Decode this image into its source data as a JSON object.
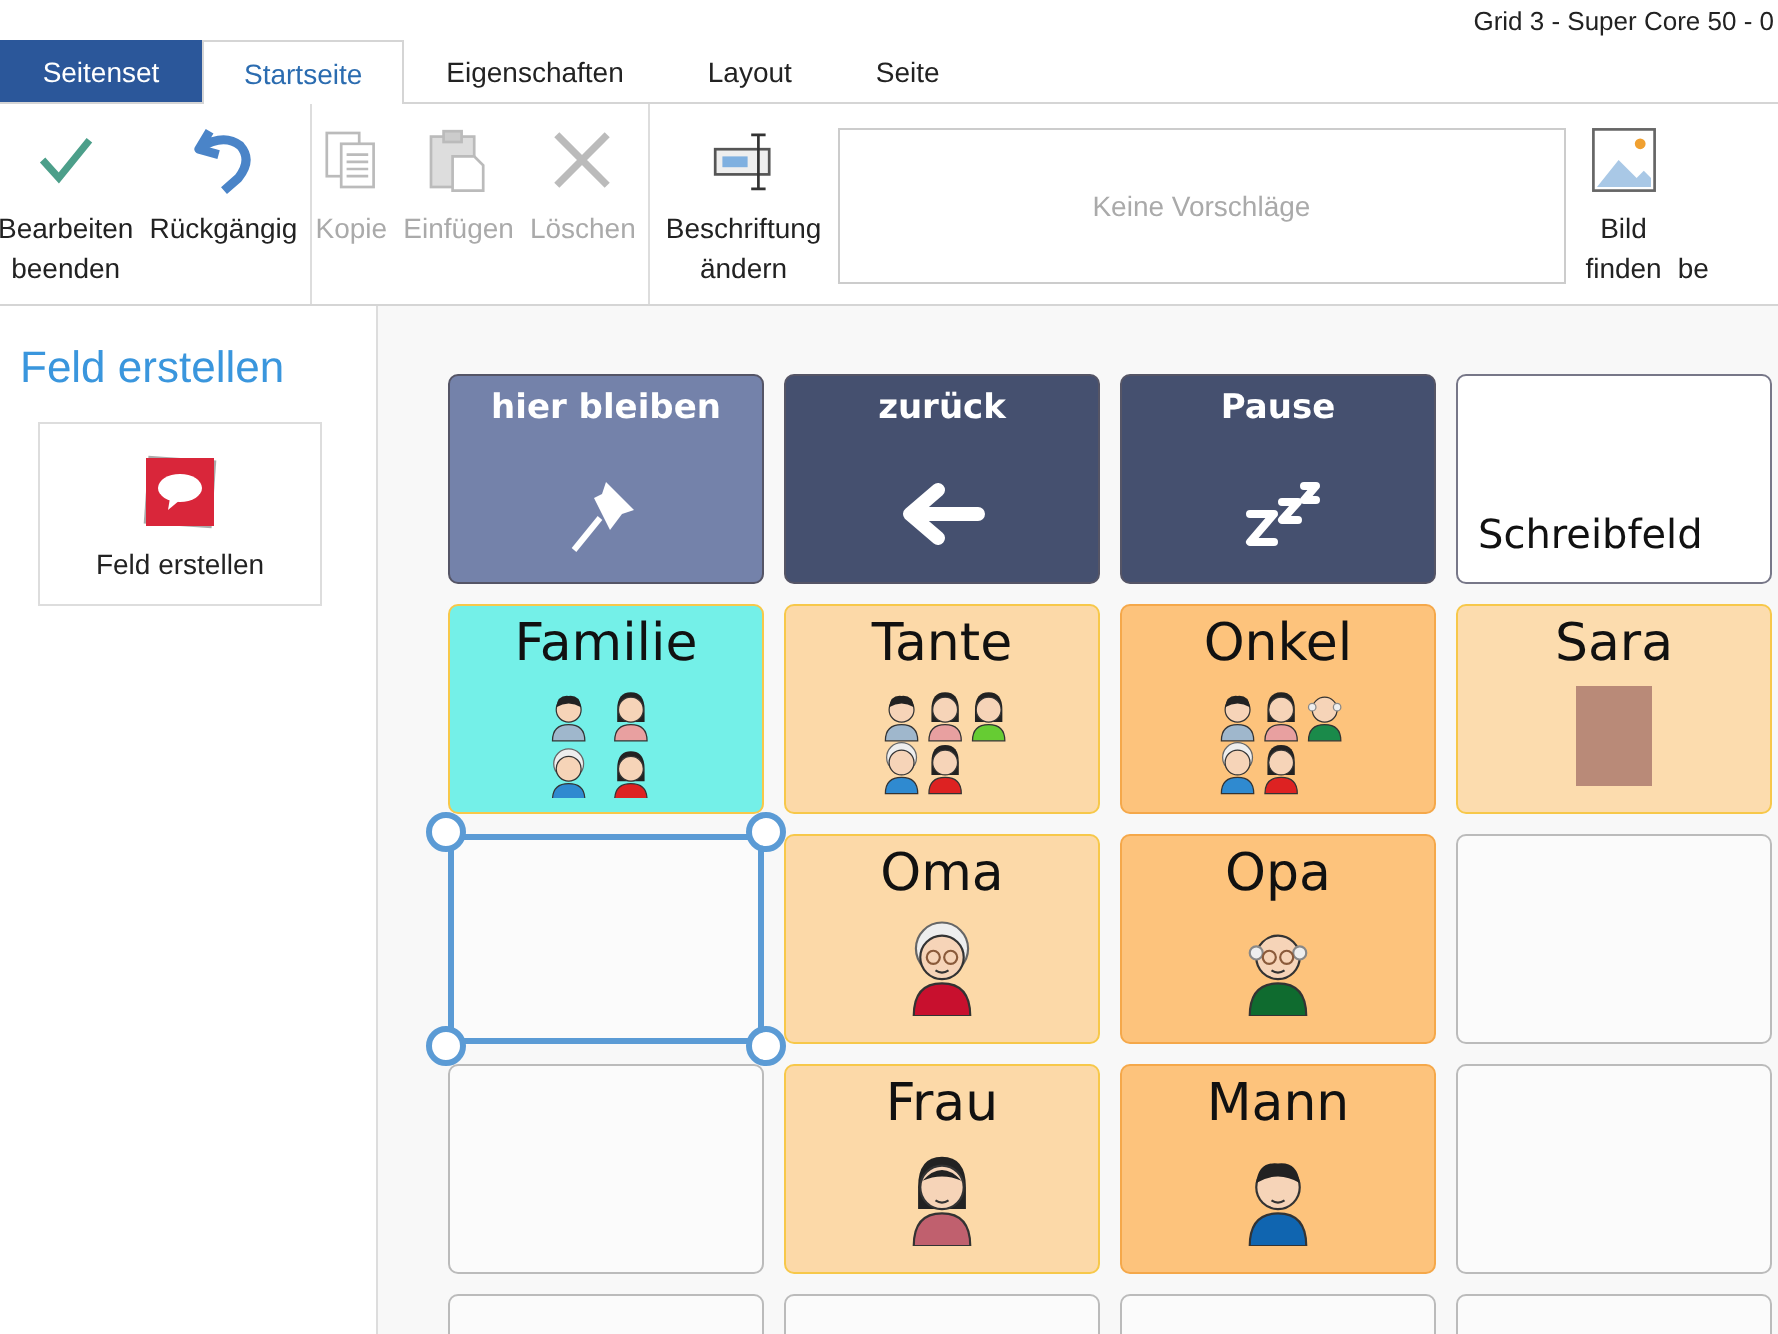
{
  "window": {
    "title": "Grid 3 - Super Core 50 - 0"
  },
  "tabs": [
    {
      "label": "Seitenset",
      "kind": "app",
      "selected": false
    },
    {
      "label": "Startseite",
      "kind": "tab",
      "selected": true
    },
    {
      "label": "Eigenschaften",
      "kind": "tab",
      "selected": false
    },
    {
      "label": "Layout",
      "kind": "tab",
      "selected": false
    },
    {
      "label": "Seite",
      "kind": "tab",
      "selected": false
    }
  ],
  "ribbon": {
    "groups": [
      {
        "items": [
          {
            "kind": "button",
            "label": "Bearbeiten\nbeenden",
            "disabled": false
          },
          {
            "kind": "button",
            "label": "Rückgängig",
            "disabled": false
          }
        ]
      },
      {
        "items": [
          {
            "kind": "button",
            "label": "Kopie",
            "disabled": true
          },
          {
            "kind": "button",
            "label": "Einfügen",
            "disabled": true
          },
          {
            "kind": "button",
            "label": "Löschen",
            "disabled": true
          }
        ]
      },
      {
        "items": [
          {
            "kind": "button",
            "label": "Beschriftung\nändern",
            "disabled": false
          },
          {
            "kind": "suggestions",
            "label": "Keine Vorschläge"
          },
          {
            "kind": "button",
            "label": "Bild\nfinden",
            "disabled": false
          },
          {
            "kind": "button",
            "label": "\nbe",
            "disabled": false
          }
        ]
      }
    ]
  },
  "sidebar": {
    "title": "Feld erstellen",
    "card": {
      "label": "Feld erstellen"
    }
  },
  "grid": {
    "cells": [
      {
        "kind": "nav",
        "label": "hier bleiben",
        "color": "#7482aa",
        "selected": false
      },
      {
        "kind": "nav",
        "label": "zurück",
        "color": "#45506f",
        "selected": false
      },
      {
        "kind": "nav",
        "label": "Pause",
        "color": "#45506f",
        "selected": false
      },
      {
        "kind": "text",
        "label": "Schreibfeld",
        "selected": false
      },
      {
        "kind": "symbol",
        "label": "Familie",
        "color": "#74f0e8",
        "selected": false
      },
      {
        "kind": "symbol",
        "label": "Tante",
        "color": "#fcd9a8",
        "selected": false
      },
      {
        "kind": "symbol",
        "label": "Onkel",
        "color": "#fdc37c",
        "selected": false
      },
      {
        "kind": "symbol",
        "label": "Sara",
        "color": "#fcdcae",
        "selected": false
      },
      {
        "kind": "empty",
        "selected": true
      },
      {
        "kind": "symbol",
        "label": "Oma",
        "color": "#fcd9a8",
        "selected": false
      },
      {
        "kind": "symbol",
        "label": "Opa",
        "color": "#fdc37c",
        "selected": false
      },
      {
        "kind": "empty",
        "selected": false
      },
      {
        "kind": "empty",
        "selected": false
      },
      {
        "kind": "symbol",
        "label": "Frau",
        "color": "#fcd9a8",
        "selected": false
      },
      {
        "kind": "symbol",
        "label": "Mann",
        "color": "#fdc37c",
        "selected": false
      },
      {
        "kind": "empty",
        "selected": false
      },
      {
        "kind": "empty",
        "selected": false
      },
      {
        "kind": "empty",
        "selected": false
      },
      {
        "kind": "empty",
        "selected": false
      },
      {
        "kind": "empty",
        "selected": false
      }
    ]
  }
}
